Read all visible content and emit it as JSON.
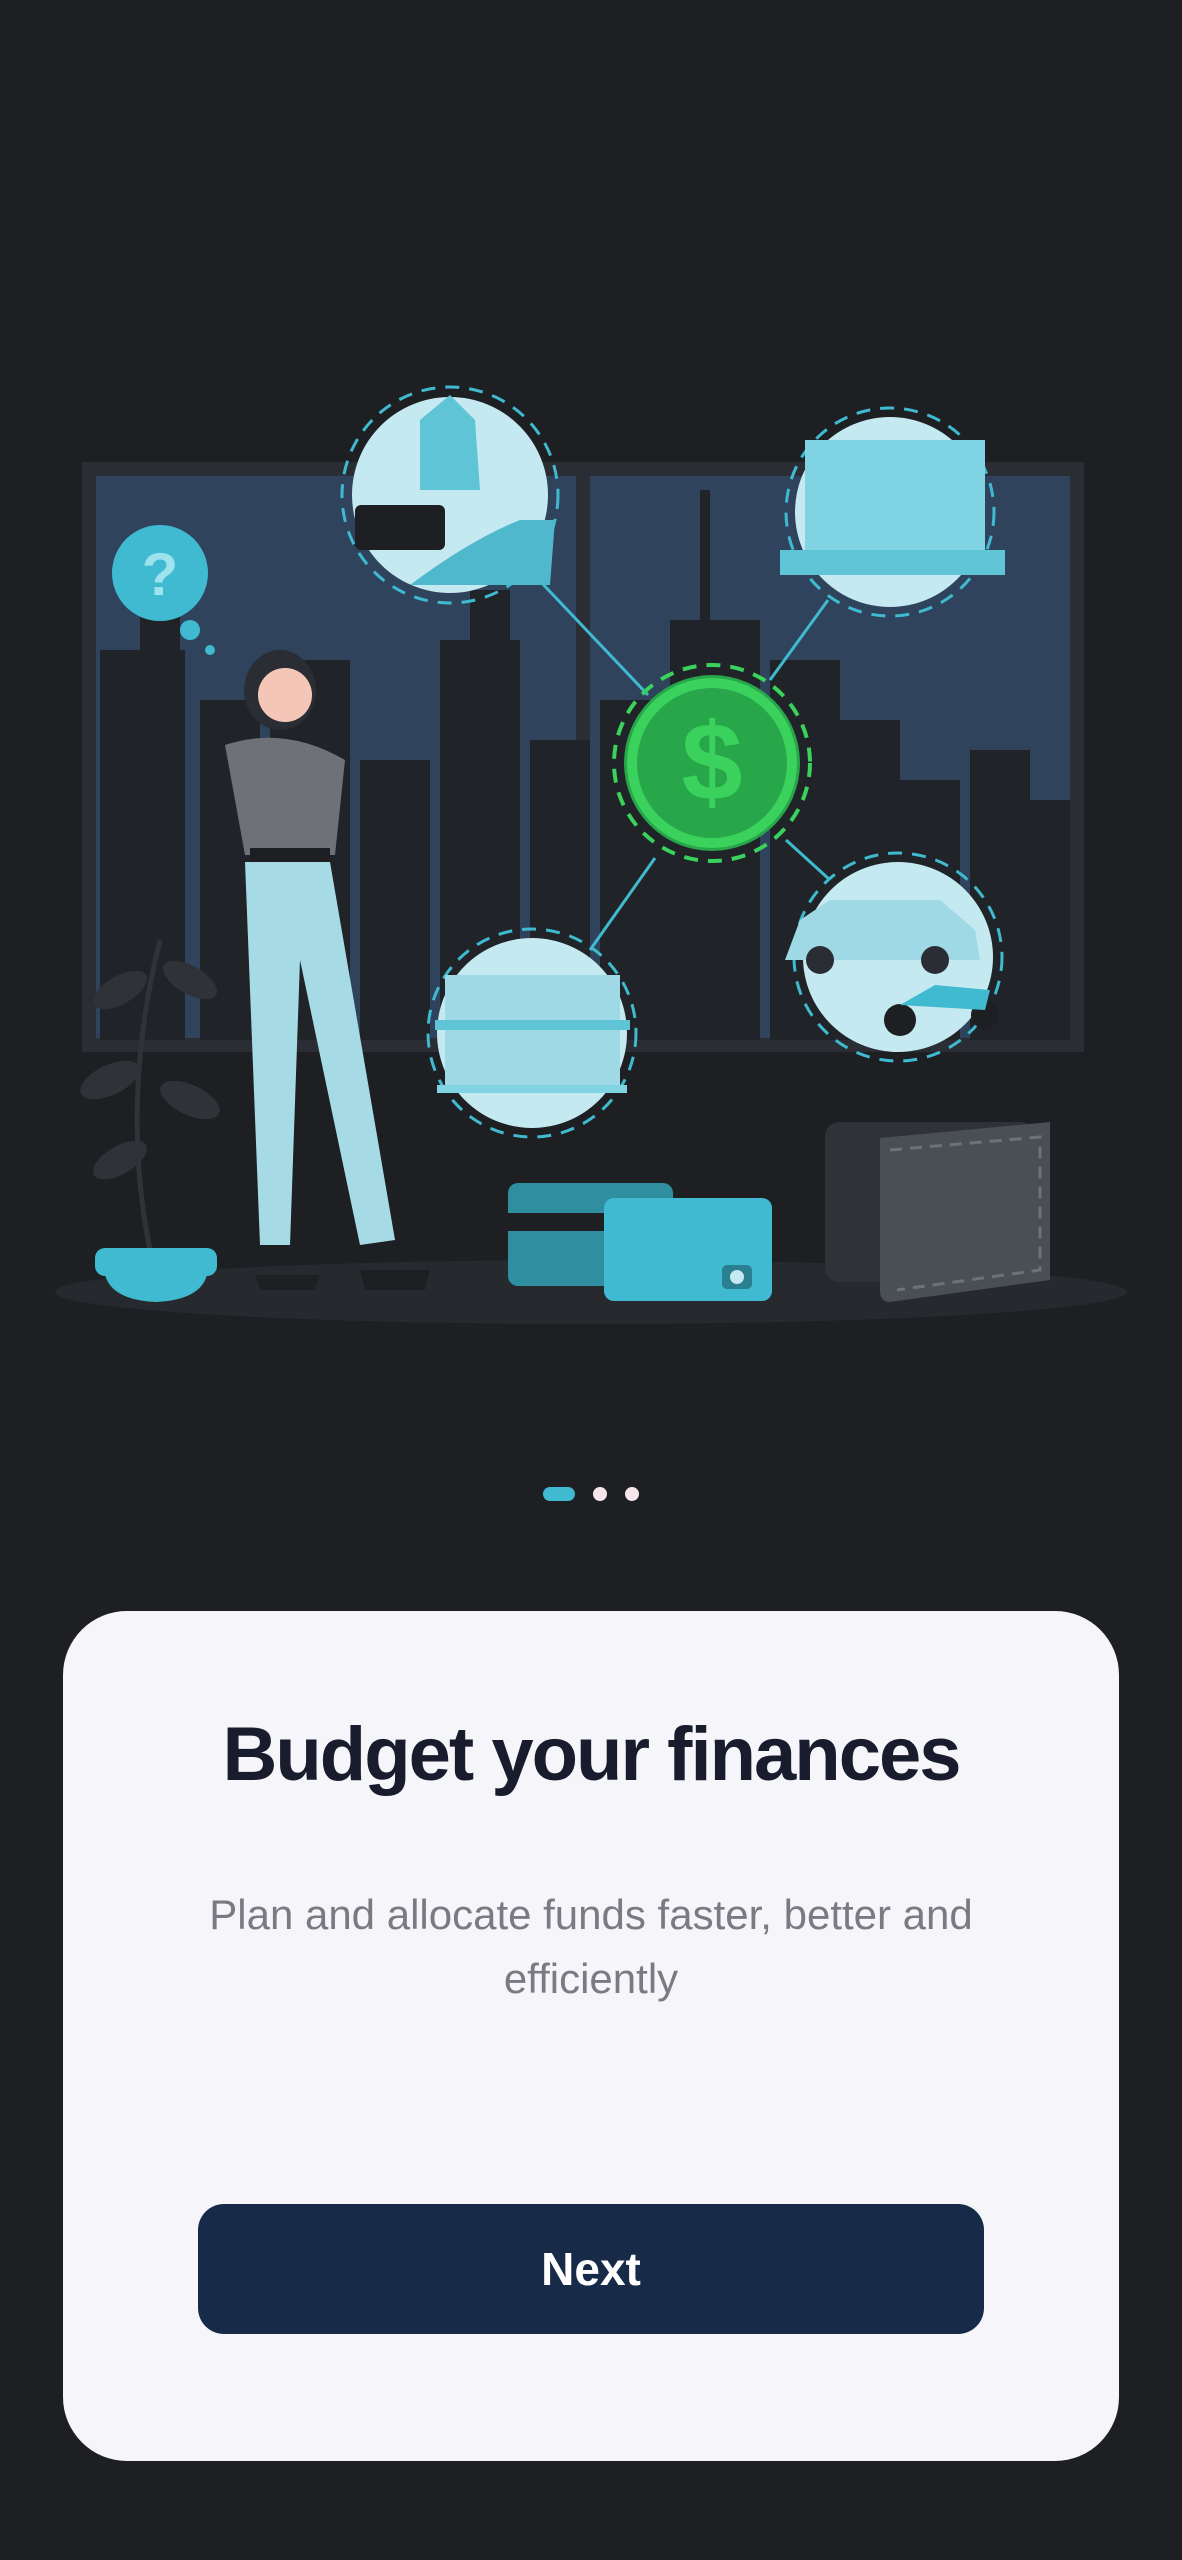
{
  "onboarding": {
    "title": "Budget your finances",
    "subtitle": "Plan and allocate funds faster, better and efficiently",
    "next_label": "Next",
    "illustration_icon_glyphs": {
      "question": "?",
      "currency": "$"
    }
  },
  "pager": {
    "total_pages": 3,
    "current_page": 1
  },
  "colors": {
    "background": "#1d1f23",
    "card": "#f6f6fa",
    "title": "#181c2c",
    "subtitle": "#7a7b82",
    "button": "#172a48",
    "accent": "#3fbad0",
    "money_green": "#3ad15c"
  }
}
